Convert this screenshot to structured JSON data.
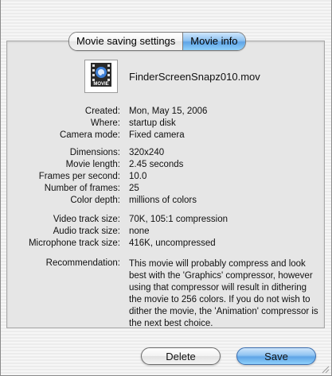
{
  "tabs": [
    {
      "label": "Movie saving settings",
      "active": false
    },
    {
      "label": "Movie info",
      "active": true
    }
  ],
  "file": {
    "icon": "quicktime-movie-icon",
    "icon_caption": "MOVIE",
    "name": "FinderScreenSnapz010.mov"
  },
  "info": {
    "created": {
      "label": "Created:",
      "value": "Mon, May 15, 2006"
    },
    "where": {
      "label": "Where:",
      "value": "startup disk"
    },
    "camera_mode": {
      "label": "Camera mode:",
      "value": "Fixed camera"
    },
    "dimensions": {
      "label": "Dimensions:",
      "value": "320x240"
    },
    "movie_length": {
      "label": "Movie length:",
      "value": "2.45 seconds"
    },
    "fps": {
      "label": "Frames per second:",
      "value": "10.0"
    },
    "num_frames": {
      "label": "Number of frames:",
      "value": "25"
    },
    "color_depth": {
      "label": "Color depth:",
      "value": "millions of colors"
    },
    "video_track": {
      "label": "Video track size:",
      "value": "70K, 105:1 compression"
    },
    "audio_track": {
      "label": "Audio track size:",
      "value": "none"
    },
    "mic_track": {
      "label": "Microphone track size:",
      "value": "416K, uncompressed"
    }
  },
  "recommendation": {
    "label": "Recommendation:",
    "text": "This movie will probably compress and look best with the 'Graphics' compressor, however using that compressor will result in dithering the movie to 256 colors.  If you do not wish to dither the movie, the 'Animation' compressor is the next best choice."
  },
  "buttons": {
    "delete": "Delete",
    "save": "Save"
  },
  "colors": {
    "accent": "#5fa4e6",
    "panel": "#e6e6e6"
  }
}
